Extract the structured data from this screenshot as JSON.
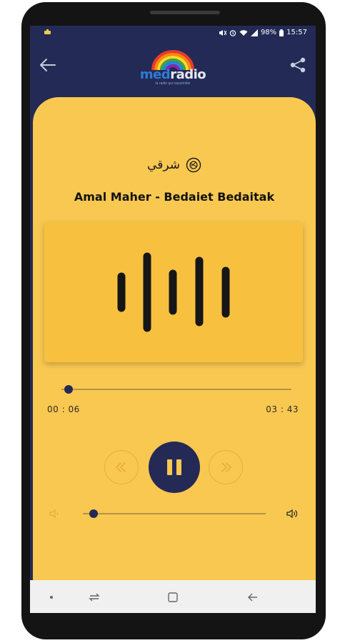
{
  "status_bar": {
    "battery": "98%",
    "time": "15:57",
    "icons": [
      "notification-icon",
      "mute-icon",
      "alarm-icon",
      "wifi-icon",
      "signal-icon",
      "battery-icon"
    ]
  },
  "app_bar": {
    "back_icon": "arrow-left-icon",
    "share_icon": "share-icon",
    "logo": {
      "part1": "med",
      "part2": "radio",
      "tagline": "la radio qui rassemble"
    }
  },
  "player": {
    "genre": "شرقي",
    "genre_icon": "disc-icon",
    "track_title": "Amal Maher - Bedaiet Bedaitak",
    "artwork_icon": "sound-wave-icon",
    "progress": 0.03,
    "elapsed": "00 : 06",
    "duration": "03 : 43",
    "controls": {
      "previous_icon": "rewind-icon",
      "pause_icon": "pause-icon",
      "next_icon": "fast-forward-icon"
    },
    "volume": 0.06
  },
  "nav_bar": {
    "icons": [
      "dot-icon",
      "recent-apps-icon",
      "home-icon",
      "back-icon"
    ]
  },
  "colors": {
    "background": "#222a55",
    "card": "#f9c851",
    "artwork": "#f7c13f",
    "accent": "#242a55",
    "ring": "#e8ad3b"
  }
}
